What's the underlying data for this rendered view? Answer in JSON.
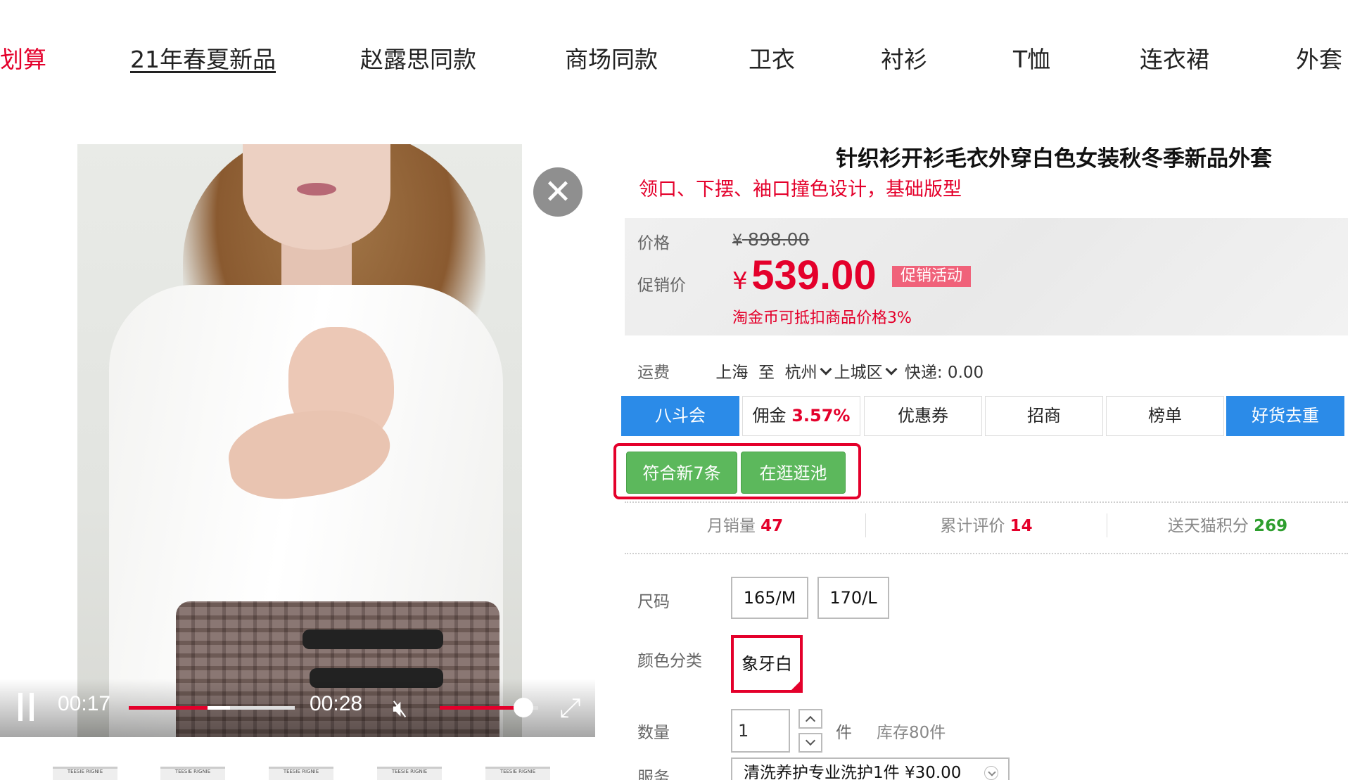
{
  "nav": {
    "items": [
      "划算",
      "21年春夏新品",
      "赵露思同款",
      "商场同款",
      "卫衣",
      "衬衫",
      "T恤",
      "连衣裙",
      "外套"
    ]
  },
  "video": {
    "current_time": "00:17",
    "duration": "00:28",
    "progress": 0.607,
    "volume": 0.85,
    "thumbnails": [
      "TEESIE RIGNIE",
      "TEESIE RIGNIE",
      "TEESIE RIGNIE",
      "TEESIE RIGNIE",
      "TEESIE RIGNIE"
    ]
  },
  "product": {
    "title": "针织衫开衫毛衣外穿白色女装秋冬季新品外套",
    "subtitle": "领口、下摆、袖口撞色设计，基础版型"
  },
  "price": {
    "price_label": "价格",
    "currency": "¥",
    "original": "898.00",
    "promo_label": "促销价",
    "promo": "539.00",
    "promo_tag": "促销活动",
    "note": "淘金币可抵扣商品价格3%"
  },
  "shipping": {
    "label": "运费",
    "from": "上海",
    "to_word": "至",
    "city": "杭州",
    "district": "上城区",
    "express": "快递: 0.00"
  },
  "tabs": {
    "t1": "八斗会",
    "t2_prefix": "佣金",
    "t2_pct": "3.57%",
    "t3": "优惠券",
    "t4": "招商",
    "t5": "榜单",
    "t6": "好货去重"
  },
  "green_buttons": [
    "符合新7条",
    "在逛逛池"
  ],
  "stats": {
    "monthly_sales_label": "月销量",
    "monthly_sales": "47",
    "reviews_label": "累计评价",
    "reviews": "14",
    "points_label": "送天猫积分",
    "points": "269"
  },
  "size": {
    "label": "尺码",
    "options": [
      "165/M",
      "170/L"
    ]
  },
  "color": {
    "label": "颜色分类",
    "selected": "象牙白"
  },
  "quantity": {
    "label": "数量",
    "value": "1",
    "unit": "件",
    "stock": "库存80件"
  },
  "service": {
    "label": "服务",
    "selected": "清洗养护专业洗护1件  ¥30.00"
  },
  "icons": {
    "close": "close-icon",
    "pause": "pause-icon",
    "mute": "mute-icon",
    "fullscreen": "fullscreen-icon"
  },
  "colors": {
    "accent_red": "#e4002b",
    "tab_blue": "#2b8be8",
    "green": "#5cb85c"
  }
}
